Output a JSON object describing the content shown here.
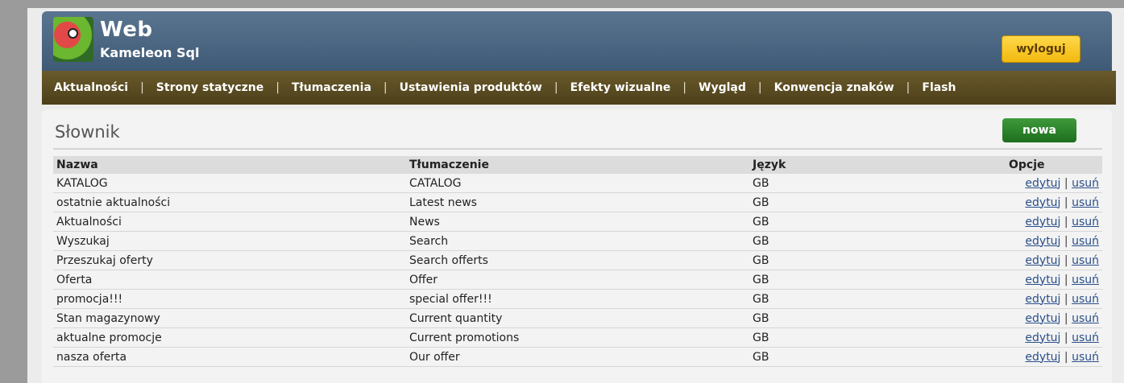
{
  "header": {
    "title": "Web",
    "subtitle": "Kameleon Sql",
    "logout_label": "wyloguj"
  },
  "nav": {
    "items": [
      {
        "label": "Aktualności"
      },
      {
        "label": "Strony statyczne"
      },
      {
        "label": "Tłumaczenia"
      },
      {
        "label": "Ustawienia produktów"
      },
      {
        "label": "Efekty wizualne"
      },
      {
        "label": "Wygląd"
      },
      {
        "label": "Konwencja znaków"
      },
      {
        "label": "Flash"
      }
    ],
    "separator": "|"
  },
  "page": {
    "title": "Słownik",
    "new_label": "nowa"
  },
  "table": {
    "headers": {
      "name": "Nazwa",
      "translation": "Tłumaczenie",
      "language": "Język",
      "options": "Opcje"
    },
    "edit_label": "edytuj",
    "delete_label": "usuń",
    "option_separator": "|",
    "rows": [
      {
        "name": "KATALOG",
        "translation": "CATALOG",
        "language": "GB"
      },
      {
        "name": "ostatnie aktualności",
        "translation": "Latest news",
        "language": "GB"
      },
      {
        "name": "Aktualności",
        "translation": "News",
        "language": "GB"
      },
      {
        "name": "Wyszukaj",
        "translation": "Search",
        "language": "GB"
      },
      {
        "name": "Przeszukaj oferty",
        "translation": "Search offerts",
        "language": "GB"
      },
      {
        "name": "Oferta",
        "translation": "Offer",
        "language": "GB"
      },
      {
        "name": "promocja!!!",
        "translation": "special offer!!!",
        "language": "GB"
      },
      {
        "name": "Stan magazynowy",
        "translation": "Current quantity",
        "language": "GB"
      },
      {
        "name": "aktualne promocje",
        "translation": "Current promotions",
        "language": "GB"
      },
      {
        "name": "nasza oferta",
        "translation": "Our offer",
        "language": "GB"
      }
    ]
  },
  "colors": {
    "header_blue": "#4a6580",
    "nav_brown": "#5a4c22",
    "logout_yellow": "#f7c52a",
    "new_green": "#2a8a2a",
    "link_blue": "#2a4f8a"
  },
  "icons": [
    "kameleon-logo-icon"
  ]
}
